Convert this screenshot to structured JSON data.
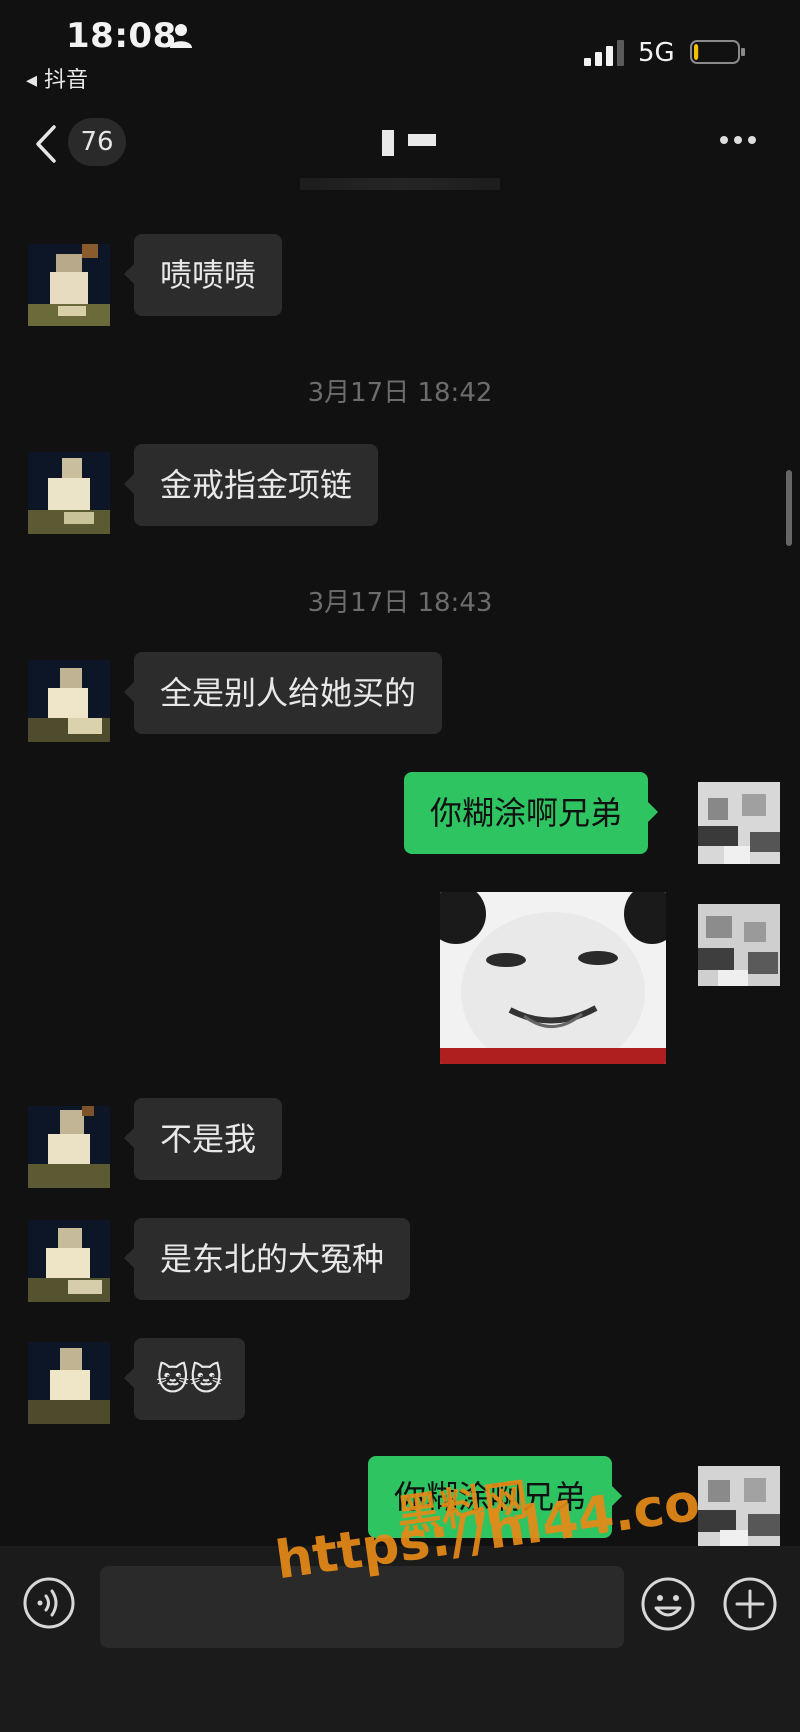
{
  "status_bar": {
    "time": "18:08",
    "back_app": "◂ 抖音",
    "network": "5G",
    "battery_level_percent": 10,
    "battery_color": "#f2c200"
  },
  "nav": {
    "unread_count": "76",
    "more_icon": "more-dots-icon",
    "back_icon": "chevron-left-icon"
  },
  "messages": [
    {
      "side": "in",
      "text": "啧啧啧"
    },
    {
      "side": "ts",
      "text": "3月17日 18:42"
    },
    {
      "side": "in",
      "text": "金戒指金项链"
    },
    {
      "side": "ts",
      "text": "3月17日 18:43"
    },
    {
      "side": "in",
      "text": "全是别人给她买的"
    },
    {
      "side": "out",
      "text": "你糊涂啊兄弟"
    },
    {
      "side": "out",
      "sticker": "panda-face-sticker"
    },
    {
      "side": "in",
      "text": "不是我"
    },
    {
      "side": "in",
      "text": "是东北的大冤种"
    },
    {
      "side": "in",
      "text": "🐱🐱"
    },
    {
      "side": "out",
      "text": "你糊涂啊兄弟"
    }
  ],
  "input": {
    "placeholder": "",
    "voice_icon": "voice-icon",
    "emoji_icon": "emoji-icon",
    "plus_icon": "plus-icon"
  },
  "watermark": {
    "cn": "黑料网",
    "url": "https://hl44.co"
  },
  "colors": {
    "background": "#111111",
    "incoming_bubble": "#2c2c2c",
    "outgoing_bubble": "#2ec462"
  }
}
